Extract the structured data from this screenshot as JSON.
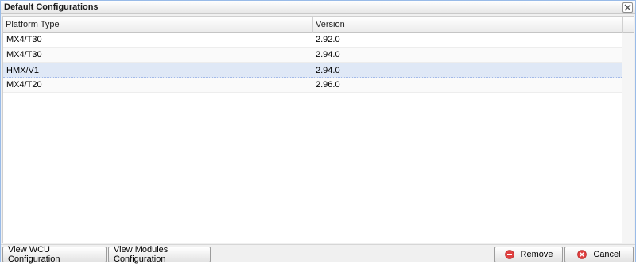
{
  "window": {
    "title": "Default Configurations"
  },
  "grid": {
    "columns": [
      "Platform Type",
      "Version"
    ],
    "rows": [
      {
        "platform": "MX4/T30",
        "version": "2.92.0"
      },
      {
        "platform": "MX4/T30",
        "version": "2.94.0"
      },
      {
        "platform": "HMX/V1",
        "version": "2.94.0"
      },
      {
        "platform": "MX4/T20",
        "version": "2.96.0"
      }
    ],
    "selected_row": 2
  },
  "toolbar": {
    "view_wcu_label": "View WCU Configuration",
    "view_modules_label": "View Modules Configuration",
    "remove_label": "Remove",
    "cancel_label": "Cancel"
  },
  "icons": {
    "close": "close-icon",
    "remove": "minus-circle-icon",
    "cancel": "cancel-circle-icon"
  },
  "colors": {
    "selection": "#dfe8f6",
    "danger": "#e04040"
  }
}
